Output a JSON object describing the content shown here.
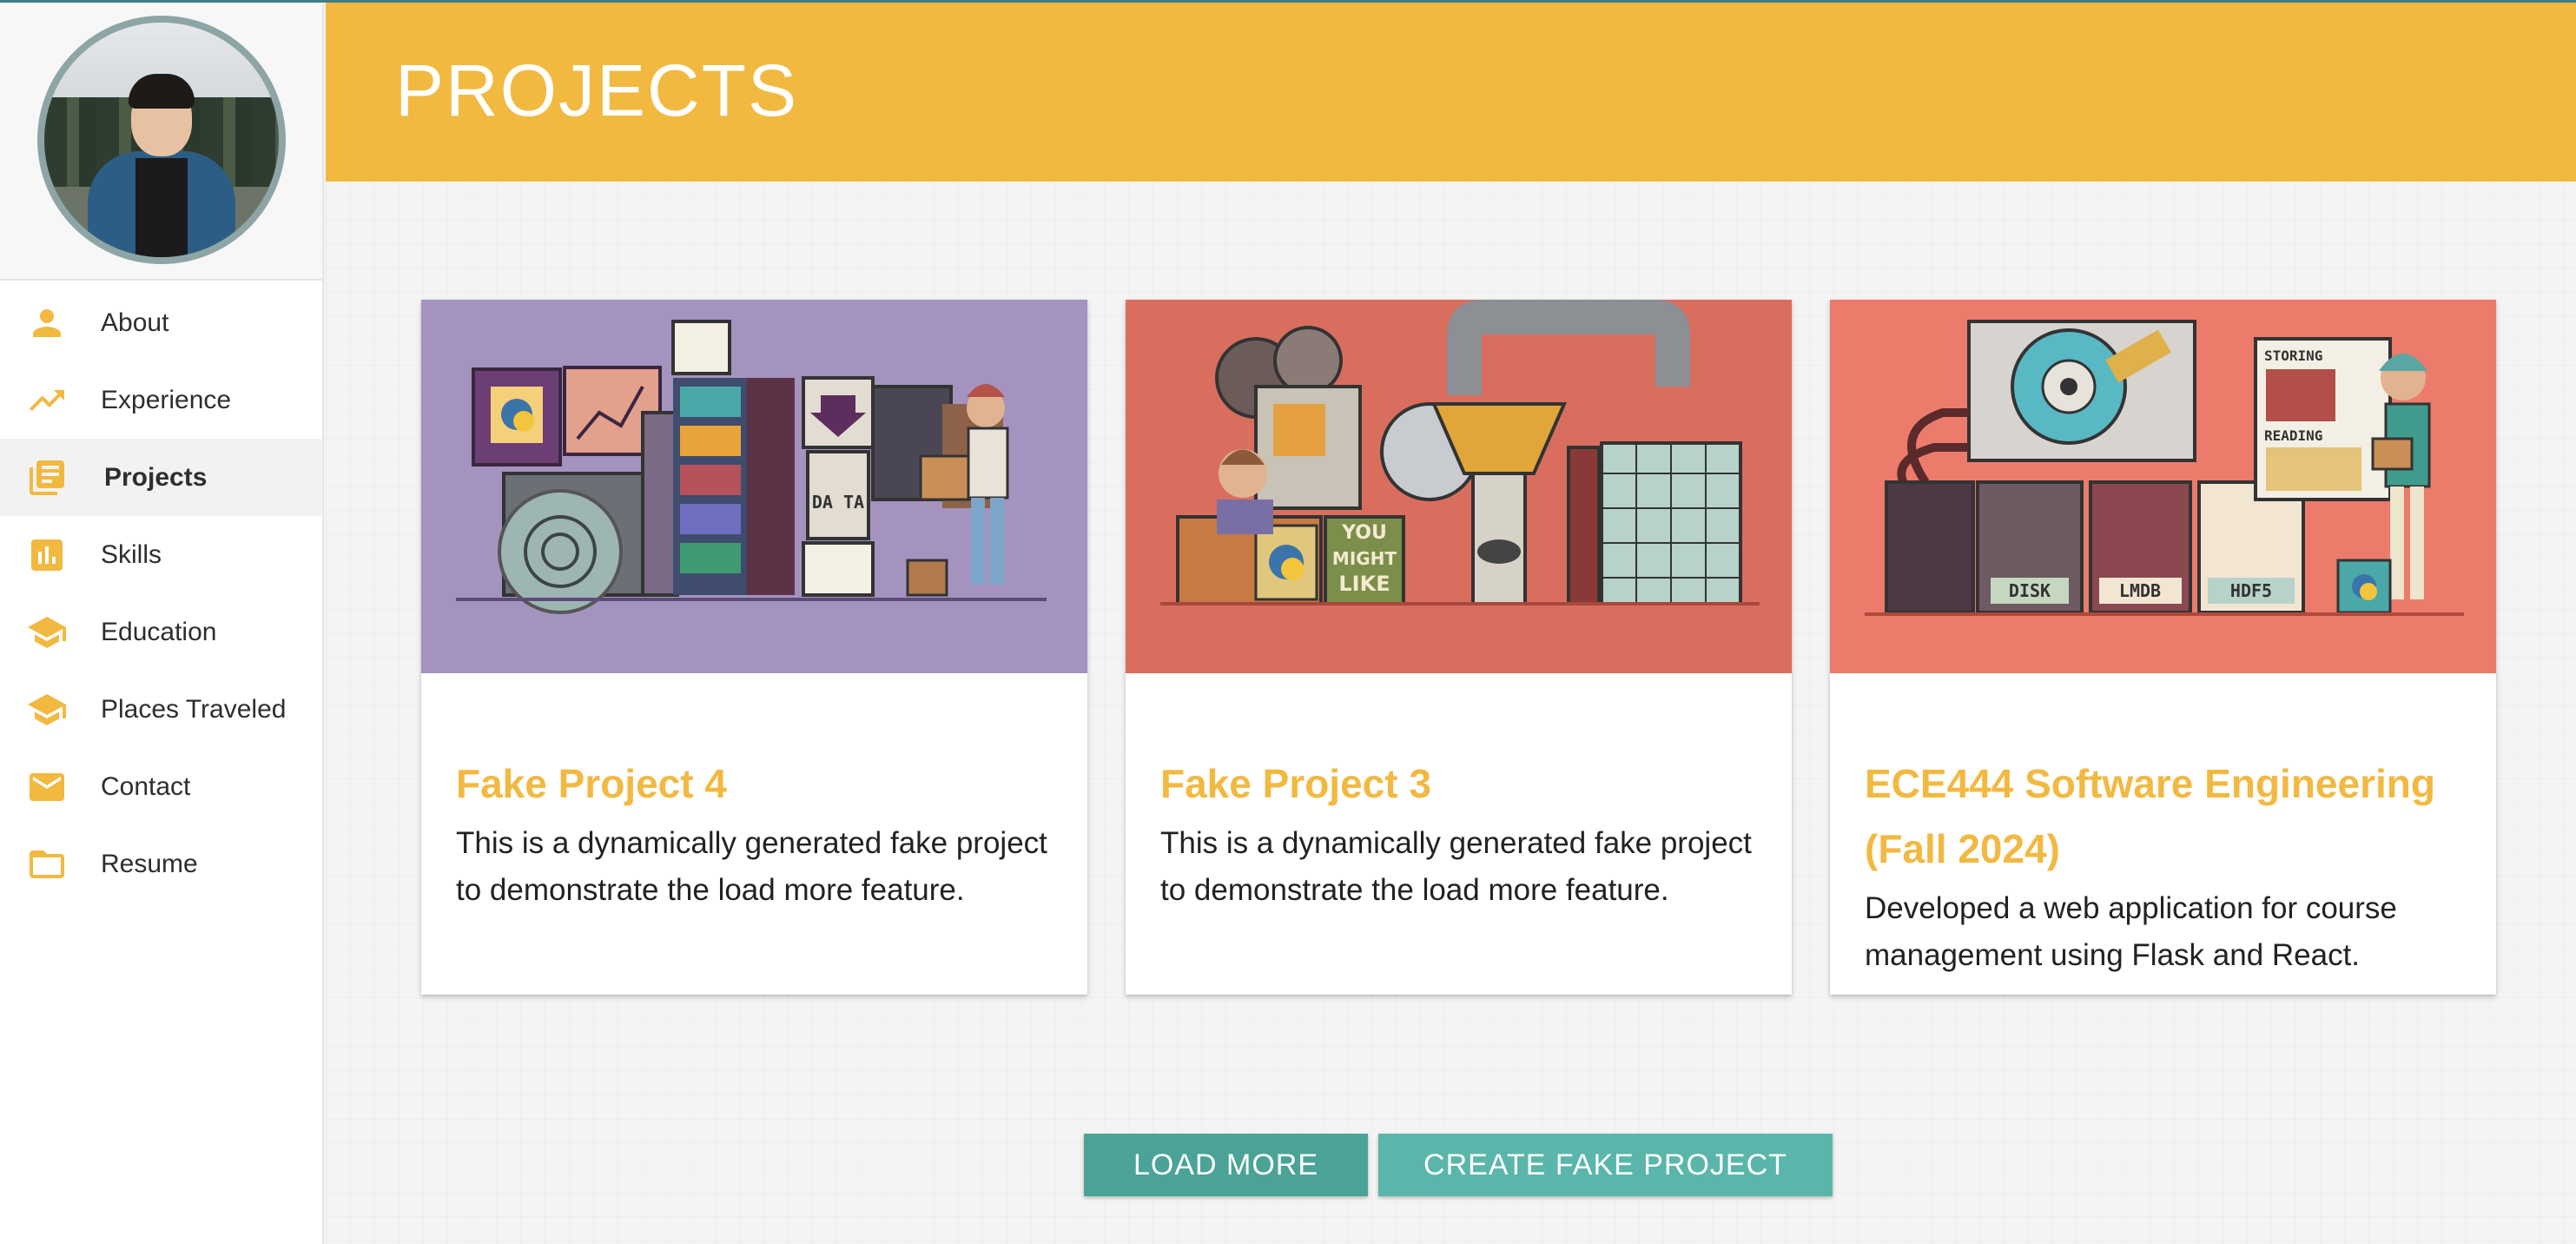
{
  "sidebar": {
    "items": [
      {
        "label": "About",
        "icon": "person-icon"
      },
      {
        "label": "Experience",
        "icon": "trending-up-icon"
      },
      {
        "label": "Projects",
        "icon": "library-books-icon"
      },
      {
        "label": "Skills",
        "icon": "bar-chart-icon"
      },
      {
        "label": "Education",
        "icon": "school-icon"
      },
      {
        "label": "Places Traveled",
        "icon": "school-icon"
      },
      {
        "label": "Contact",
        "icon": "email-icon"
      },
      {
        "label": "Resume",
        "icon": "folder-icon"
      }
    ],
    "active": "Projects"
  },
  "header": {
    "title": "PROJECTS"
  },
  "cards": [
    {
      "title": "Fake Project 4",
      "description": "This is a dynamically generated fake project to demonstrate the load more feature.",
      "image_bg": "#a593bf"
    },
    {
      "title": "Fake Project 3",
      "description": "This is a dynamically generated fake project to demonstrate the load more feature.",
      "image_bg": "#d96e5f"
    },
    {
      "title": "ECE444 Software Engineering (Fall 2024)",
      "description": "Developed a web application for course management using Flask and React.",
      "image_bg": "#ec7b6c"
    }
  ],
  "illustration_text": {
    "card1_data": "DA TA",
    "card2_you": "YOU",
    "card2_might": "MIGHT",
    "card2_like": "LIKE",
    "card3_storing": "STORING",
    "card3_reading": "READING",
    "card3_disk": "DISK",
    "card3_lmdb": "LMDB",
    "card3_hdf5": "HDF5"
  },
  "buttons": {
    "load_more": "LOAD MORE",
    "create_fake": "CREATE FAKE PROJECT"
  },
  "colors": {
    "accent": "#f2b941",
    "teal": "#4ba397",
    "teal_light": "#5ab6aa"
  }
}
